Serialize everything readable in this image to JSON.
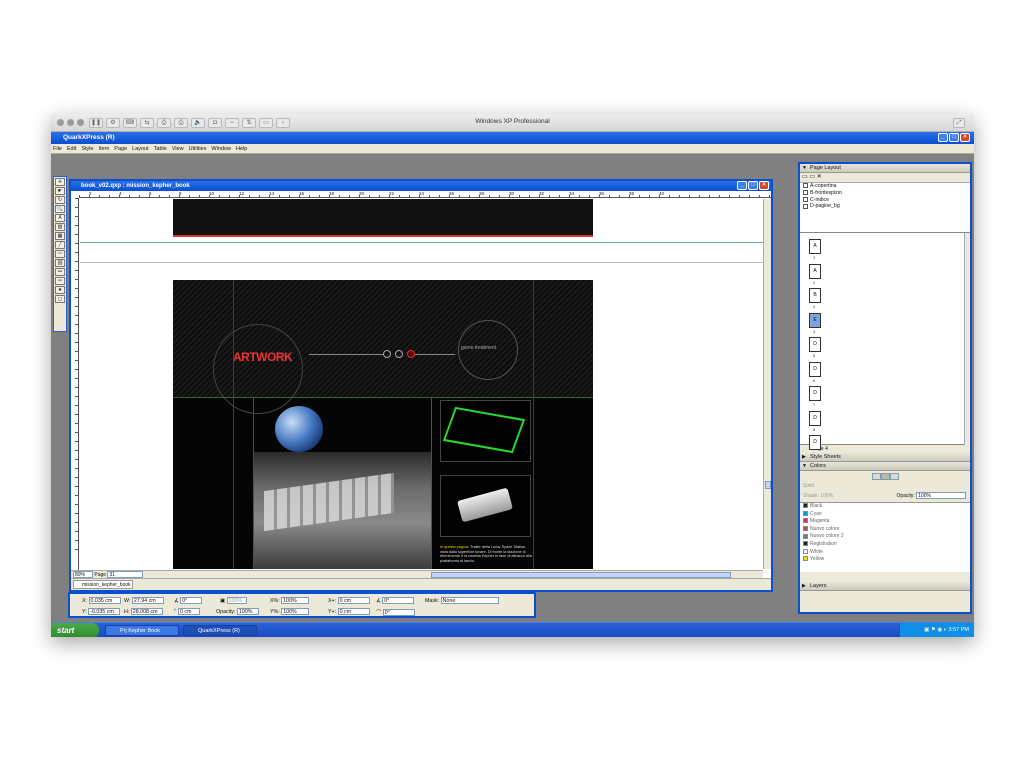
{
  "mac": {
    "title": "Windows XP Professional",
    "toolbar_icons": [
      "pause-icon",
      "settings-icon",
      "keyboard-icon",
      "transfer-icon",
      "print-icon",
      "print-alt-icon",
      "volume-icon",
      "camera-icon",
      "usb-icon",
      "network-icon",
      "folder-icon",
      "collapse-icon"
    ]
  },
  "app": {
    "title": "QuarkXPress (R)",
    "menu": [
      "File",
      "Edit",
      "Style",
      "Item",
      "Page",
      "Layout",
      "Table",
      "View",
      "Utilities",
      "Window",
      "Help"
    ]
  },
  "tools": [
    "item-tool",
    "content-tool",
    "rotate-tool",
    "zoom-tool",
    "text-box-tool",
    "picture-box-tool",
    "table-tool",
    "line-tool",
    "text-path-tool",
    "linking-tool",
    "unlinking-tool",
    "scissors-tool",
    "star-tool",
    "frame-tool"
  ],
  "document": {
    "title": "book_v02.qxp : mission_kepher_book",
    "ruler_labels": [
      "2",
      "4",
      "6",
      "8",
      "10",
      "12",
      "14",
      "16",
      "18",
      "20",
      "22",
      "24",
      "26",
      "28",
      "30",
      "32",
      "34",
      "36",
      "38",
      "40"
    ],
    "zoom": "80%",
    "page_label": "Page",
    "page_value": "31",
    "layout_tab": "mission_kepher_book",
    "spread": {
      "logo_text": "ARTWORK",
      "subtitle": "game treatment",
      "body_highlight": "In questa pagina:",
      "body_text": "Trailer della Lunar Space Station, vista dalla superficie lunare. Di fronte la stazione di rifornimento e la navetta Kepher in fase di attracco alla piattaforma di lancio."
    }
  },
  "layout_palette": {
    "title": "Page Layout",
    "masters": [
      "A-copertina",
      "B-frontespizio",
      "C-indice",
      "D-pagine_bg"
    ],
    "pages": [
      {
        "label": "A",
        "num": "1",
        "selected": false
      },
      {
        "label": "A",
        "num": "2",
        "selected": false
      },
      {
        "label": "B",
        "num": "3",
        "selected": false
      },
      {
        "label": "E",
        "num": "4",
        "selected": true
      },
      {
        "label": "D",
        "num": "5",
        "selected": false
      },
      {
        "label": "D",
        "num": "6",
        "selected": false
      },
      {
        "label": "D",
        "num": "7",
        "selected": false
      },
      {
        "label": "D",
        "num": "8",
        "selected": false
      },
      {
        "label": "D",
        "num": "9",
        "selected": false
      }
    ],
    "status": "Page 4"
  },
  "style_sheets": {
    "title": "Style Sheets"
  },
  "colors_palette": {
    "title": "Colors",
    "solid_label": "Solid",
    "shade_label": "Shade:",
    "shade_value": "100%",
    "opacity_label": "Opacity:",
    "opacity_value": "100%",
    "colors": [
      {
        "name": "Black",
        "swatch": "#222222"
      },
      {
        "name": "Cyan",
        "swatch": "#00a0e0"
      },
      {
        "name": "Magenta",
        "swatch": "#e0207a"
      },
      {
        "name": "Nuovo colore",
        "swatch": "#b05050"
      },
      {
        "name": "Nuovo colore 2",
        "swatch": "#708090"
      },
      {
        "name": "Registration",
        "swatch": "#222222"
      },
      {
        "name": "White",
        "swatch": "#ffffff"
      },
      {
        "name": "Yellow",
        "swatch": "#f0e000"
      }
    ]
  },
  "layers_palette": {
    "title": "Layers"
  },
  "measurements": {
    "x_label": "X:",
    "x": "0.035 cm",
    "y_label": "Y:",
    "y": "-0.035 cm",
    "w_label": "W:",
    "w": "27.94 cm",
    "h_label": "H:",
    "h": "28.008 cm",
    "angle": "0°",
    "corner": "0 cm",
    "opacity_label": "Opacity:",
    "opacity": "100%",
    "scale_x_label": "X%:",
    "scale_x": "100%",
    "scale_y_label": "Y%:",
    "scale_y": "100%",
    "offset_x_label": "X+:",
    "offset_x": "0 cm",
    "offset_y_label": "Y+:",
    "offset_y": "0 cm",
    "rot": "0°",
    "skew": "0°",
    "shade": "100%",
    "mask_label": "Mask:",
    "mask": "None"
  },
  "taskbar": {
    "start": "start",
    "tasks": [
      {
        "label": "Prj Kepher Book",
        "active": false
      },
      {
        "label": "QuarkXPress (R)",
        "active": true
      }
    ],
    "clock": "3:57 PM"
  }
}
